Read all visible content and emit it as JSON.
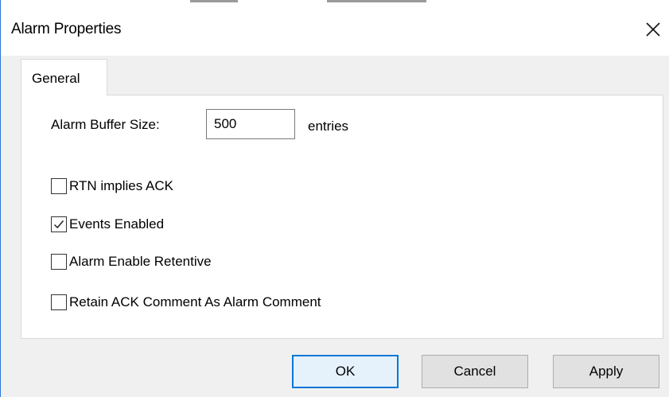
{
  "window": {
    "title": "Alarm Properties"
  },
  "tabs": [
    {
      "label": "General"
    }
  ],
  "general": {
    "buffer_label": "Alarm Buffer Size:",
    "buffer_value": "500",
    "buffer_unit": "entries",
    "options": [
      {
        "label": "RTN implies ACK",
        "checked": false
      },
      {
        "label": "Events Enabled",
        "checked": true
      },
      {
        "label": "Alarm Enable Retentive",
        "checked": false
      },
      {
        "label": "Retain ACK Comment As Alarm Comment",
        "checked": false
      }
    ]
  },
  "buttons": {
    "ok": "OK",
    "cancel": "Cancel",
    "apply": "Apply"
  },
  "icons": {
    "close": "close-icon",
    "check": "checkmark-icon"
  },
  "colors": {
    "accent": "#0078d7",
    "window_border": "#2b78d6",
    "dialog_bg": "#f0f0f0"
  }
}
